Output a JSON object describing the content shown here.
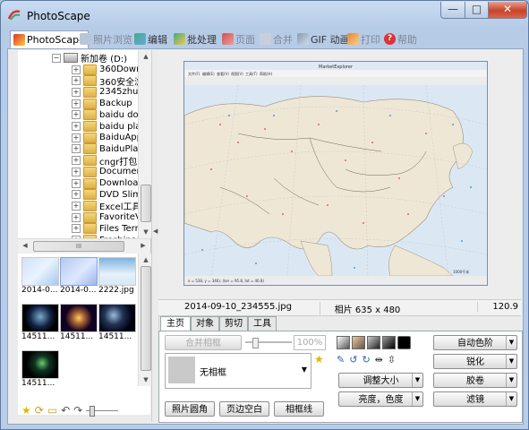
{
  "window": {
    "title": "PhotoScape",
    "min_label": "—",
    "max_label": "□",
    "close_label": "✕"
  },
  "menu": [
    {
      "label": "PhotoScape",
      "icon": "photoscape-icon",
      "active": true
    },
    {
      "label": "照片浏览",
      "icon": "viewer-icon",
      "active": false
    },
    {
      "label": "编辑",
      "icon": "editor-icon",
      "active": false
    },
    {
      "label": "批处理",
      "icon": "batch-icon",
      "active": false
    },
    {
      "label": "页面",
      "icon": "page-icon",
      "active": false
    },
    {
      "label": "合并",
      "icon": "combine-icon",
      "active": false
    },
    {
      "label": "GIF 动画",
      "icon": "gif-icon",
      "active": false
    },
    {
      "label": "打印",
      "icon": "print-icon",
      "active": false
    },
    {
      "label": "帮助",
      "icon": "help-icon",
      "active": false
    }
  ],
  "tree": {
    "drive": "新加卷 (D:)",
    "folders": [
      "360Downlo",
      "360安全浏览",
      "2345zhushd",
      "Backup",
      "baidu down",
      "baidu player",
      "BaiduAppDa",
      "BaiduPlayer",
      "cngr打包方式",
      "Documents",
      "Downloads",
      "DVD Slim Fr",
      "Excel工具集",
      "FavoriteVide",
      "Files Termin",
      "FreshinaMe"
    ]
  },
  "hscroll_label": "III",
  "thumbnails": [
    {
      "label": "2014-0..."
    },
    {
      "label": "2014-0..."
    },
    {
      "label": "2222.jpg"
    },
    {
      "label": "14511..."
    },
    {
      "label": "14511..."
    },
    {
      "label": "14511..."
    },
    {
      "label": "14511..."
    }
  ],
  "photo": {
    "app_title": "MarketExplorer",
    "menu": [
      "文件(F)",
      "编辑(E)",
      "查看(V)",
      "视图(V)",
      "工具(T)",
      "帮助(H)"
    ],
    "status": "x = 538, y = 346), (lon = 95.8, lat = 40.8)",
    "scale": "1000千米"
  },
  "status": {
    "filename": "2014-09-10_234555.jpg",
    "size": "相片 635 x 480",
    "zoom": "120.9"
  },
  "editor_tabs": [
    "主页",
    "对象",
    "剪切",
    "工具"
  ],
  "panel": {
    "merge_frame": "合并相框",
    "percent": "100%",
    "frame_name": "无相框",
    "round_button": "照片圆角",
    "margin_button": "页边空白",
    "frame_line_button": "相框线",
    "auto_level": "自动色阶",
    "sharpen": "锐化",
    "resize": "调整大小",
    "film": "胶卷",
    "brightness": "亮度，色度",
    "filter": "滤镜"
  },
  "colors": {
    "accent": "#c7432a",
    "folder": "#e9c35c",
    "window_frame": "#b6cbe6"
  }
}
